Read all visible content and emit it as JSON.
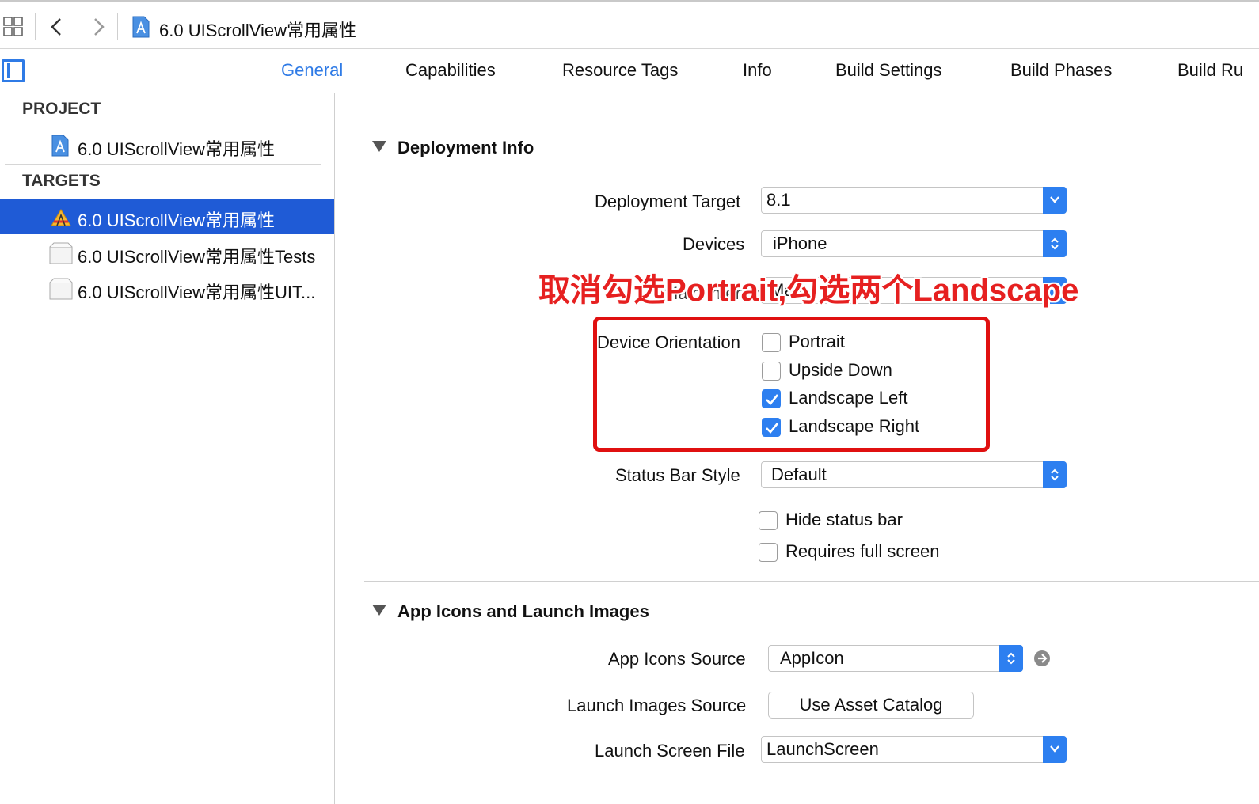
{
  "breadcrumb": {
    "title": "6.0  UIScrollView常用属性"
  },
  "tabs": [
    {
      "label": "General",
      "active": true
    },
    {
      "label": "Capabilities"
    },
    {
      "label": "Resource Tags"
    },
    {
      "label": "Info"
    },
    {
      "label": "Build Settings"
    },
    {
      "label": "Build Phases"
    },
    {
      "label": "Build Ru"
    }
  ],
  "sidebar": {
    "project_heading": "PROJECT",
    "project_item": "6.0  UIScrollView常用属性",
    "targets_heading": "TARGETS",
    "targets": [
      {
        "label": "6.0  UIScrollView常用属性",
        "selected": true
      },
      {
        "label": "6.0  UIScrollView常用属性Tests"
      },
      {
        "label": "6.0  UIScrollView常用属性UIT..."
      }
    ]
  },
  "deployment": {
    "section_title": "Deployment Info",
    "target_label": "Deployment Target",
    "target_value": "8.1",
    "devices_label": "Devices",
    "devices_value": "iPhone",
    "main_interface_label_partial": "Main Interface",
    "main_interface_value_partial": "Main",
    "orientation_label": "Device Orientation",
    "orientations": [
      {
        "label": "Portrait",
        "checked": false
      },
      {
        "label": "Upside Down",
        "checked": false
      },
      {
        "label": "Landscape Left",
        "checked": true
      },
      {
        "label": "Landscape Right",
        "checked": true
      }
    ],
    "status_bar_label": "Status Bar Style",
    "status_bar_value": "Default",
    "hide_status_bar": "Hide status bar",
    "requires_full_screen": "Requires full screen"
  },
  "app_icons": {
    "section_title": "App Icons and Launch Images",
    "icons_source_label": "App Icons Source",
    "icons_source_value": "AppIcon",
    "launch_images_label": "Launch Images Source",
    "launch_images_button": "Use Asset Catalog",
    "launch_screen_label": "Launch Screen File",
    "launch_screen_value": "LaunchScreen"
  },
  "annotation": {
    "text": "取消勾选Portrait,勾选两个Landscape",
    "color": "#e62020"
  },
  "colors": {
    "accent": "#2f7be6",
    "selection": "#1f5bd6",
    "annotation_box": "#e01010"
  }
}
